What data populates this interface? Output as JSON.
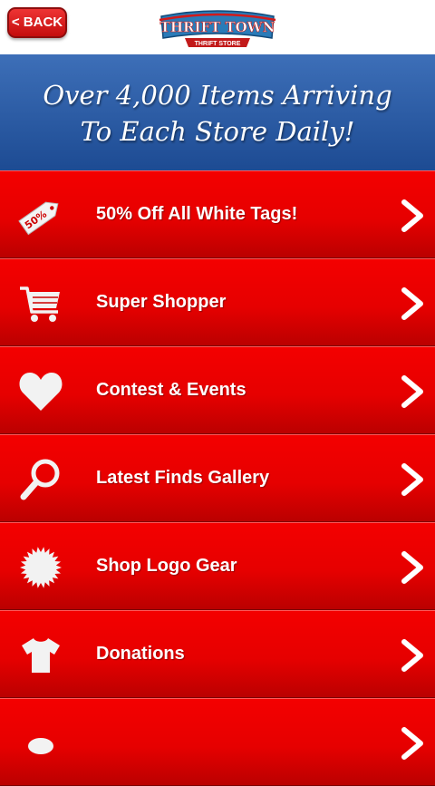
{
  "header": {
    "back_label": "< BACK",
    "logo_line1": "THRIFT TOWN",
    "logo_line2": "THRIFT STORE"
  },
  "banner": {
    "line1": "Over 4,000 Items Arriving",
    "line2": "To Each Store Daily!"
  },
  "menu": {
    "items": [
      {
        "label": "50% Off All White Tags!",
        "icon": "price-tag-icon",
        "tag_text": "50%"
      },
      {
        "label": "Super Shopper",
        "icon": "shopping-cart-icon"
      },
      {
        "label": "Contest & Events",
        "icon": "heart-icon"
      },
      {
        "label": "Latest Finds Gallery",
        "icon": "magnifying-glass-icon"
      },
      {
        "label": "Shop Logo Gear",
        "icon": "starburst-icon"
      },
      {
        "label": "Donations",
        "icon": "t-shirt-icon"
      },
      {
        "label": "",
        "icon": "partial-icon"
      }
    ]
  },
  "colors": {
    "menu_red": "#e60000",
    "banner_blue": "#2a5aa3",
    "back_red": "#d41b1b"
  }
}
